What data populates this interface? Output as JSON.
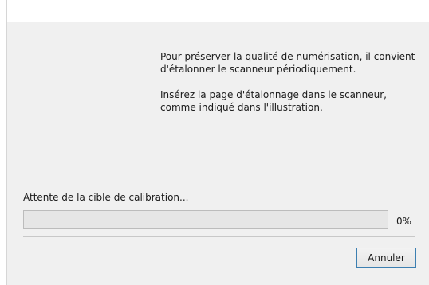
{
  "instructions": {
    "paragraph1": "Pour préserver la qualité de numérisation, il convient d'étalonner le scanneur périodiquement.",
    "paragraph2": "Insérez la page d'étalonnage dans le scanneur, comme indiqué dans l'illustration."
  },
  "status": {
    "text": "Attente de la cible de calibration..."
  },
  "progress": {
    "value": 0,
    "label": "0%",
    "fill_color": "#06b025"
  },
  "buttons": {
    "cancel_label": "Annuler"
  },
  "colors": {
    "dialog_background": "#f0f0f0",
    "button_border": "#3c7fb1"
  }
}
